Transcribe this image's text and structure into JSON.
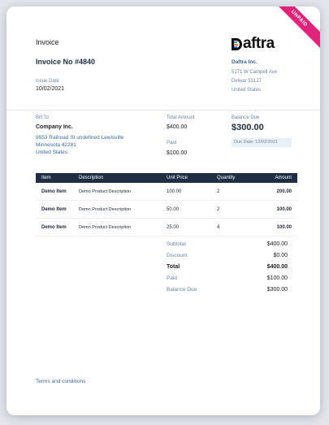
{
  "badge": "UNPAID",
  "invoice": {
    "heading": "Invoice",
    "number": "Invoice No #4840",
    "issue_date_label": "Issue Date",
    "issue_date": "10/02/2021"
  },
  "brand": {
    "logo_text": "aftra"
  },
  "company": {
    "name": "Daftra Inc.",
    "address1": "5171 W Campell Ave",
    "address2": "Delwar 53127",
    "country": "United States"
  },
  "bill_to": {
    "label": "Bill To",
    "name": "Company Inc.",
    "address1": "9553 Railroad St undefined Lewisville",
    "address2": "Minnesota 42281",
    "country": "United States"
  },
  "summary": {
    "total_amount_label": "Total Amount",
    "total_amount": "$400.00",
    "paid_label": "Paid",
    "paid": "$100.00",
    "balance_due_label": "Balance Due",
    "balance_due": "$300.00",
    "due_date": "Due Date: 12/02/2021"
  },
  "table": {
    "headers": [
      "Item",
      "Description",
      "Unit Price",
      "Quantity",
      "Amount"
    ],
    "rows": [
      [
        "Demo Item",
        "Demo Product Description",
        "100.00",
        "2",
        "200.00"
      ],
      [
        "Demo Item",
        "Demo Product Description",
        "50.00",
        "2",
        "100.00"
      ],
      [
        "Demo Item",
        "Demo Product Description",
        "25.00",
        "4",
        "100.00"
      ]
    ]
  },
  "totals": {
    "subtotal_label": "Subtotal",
    "subtotal": "$400.00",
    "discount_label": "Discount",
    "discount": "$0.00",
    "total_label": "Total",
    "total": "$400.00",
    "paid_label": "Paid",
    "paid": "$100.00",
    "balance_label": "Balance Due",
    "balance": "$300.00"
  },
  "footer": {
    "terms": "Terms and conditions"
  }
}
